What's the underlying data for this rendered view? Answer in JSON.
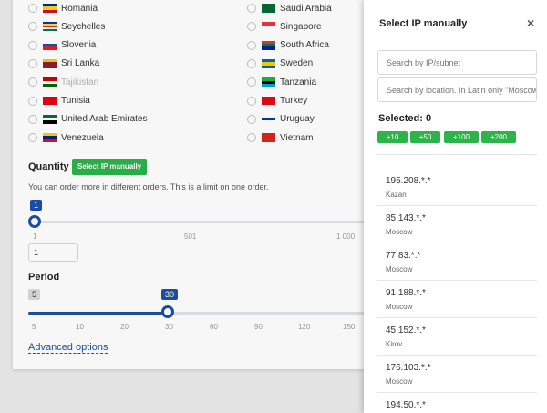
{
  "countries_left": [
    {
      "name": "Romania",
      "dim": false,
      "flag": [
        "#002b7f",
        "#fcd116",
        "#ce1126"
      ]
    },
    {
      "name": "Seychelles",
      "dim": false,
      "flag": [
        "#003f87",
        "#fcd856",
        "#d62828",
        "#ffffff",
        "#007a3d"
      ]
    },
    {
      "name": "Slovenia",
      "dim": false,
      "flag": [
        "#ffffff",
        "#005da4",
        "#ed1c24"
      ]
    },
    {
      "name": "Sri Lanka",
      "dim": false,
      "flag": [
        "#ffbe29",
        "#8d2029",
        "#8d2029"
      ]
    },
    {
      "name": "Tajikistan",
      "dim": true,
      "flag": [
        "#cc0000",
        "#ffffff",
        "#006600"
      ]
    },
    {
      "name": "Tunisia",
      "dim": false,
      "flag": [
        "#e70013",
        "#e70013",
        "#e70013"
      ]
    },
    {
      "name": "United Arab Emirates",
      "dim": false,
      "flag": [
        "#00732f",
        "#ffffff",
        "#000000"
      ]
    },
    {
      "name": "Venezuela",
      "dim": false,
      "flag": [
        "#ffcc00",
        "#00247d",
        "#cf142b"
      ]
    }
  ],
  "countries_right": [
    {
      "name": "Saudi Arabia",
      "dim": false,
      "flag": [
        "#006c35",
        "#006c35",
        "#006c35"
      ]
    },
    {
      "name": "Singapore",
      "dim": false,
      "flag": [
        "#ef3340",
        "#ffffff"
      ]
    },
    {
      "name": "South Africa",
      "dim": false,
      "flag": [
        "#de3831",
        "#007a4d",
        "#002395"
      ]
    },
    {
      "name": "Sweden",
      "dim": false,
      "flag": [
        "#006aa7",
        "#fecc00",
        "#006aa7"
      ]
    },
    {
      "name": "Tanzania",
      "dim": false,
      "flag": [
        "#1eb53a",
        "#000000",
        "#00a3dd"
      ]
    },
    {
      "name": "Turkey",
      "dim": false,
      "flag": [
        "#e30a17",
        "#e30a17",
        "#e30a17"
      ]
    },
    {
      "name": "Uruguay",
      "dim": false,
      "flag": [
        "#ffffff",
        "#0038a8",
        "#ffffff"
      ]
    },
    {
      "name": "Vietnam",
      "dim": false,
      "flag": [
        "#da251d",
        "#da251d",
        "#da251d"
      ]
    }
  ],
  "quantity": {
    "label": "Quantity",
    "select_button": "Select IP manually",
    "note": "You can order more in different orders. This is a limit on one order.",
    "value_bubble": "1",
    "ticks": [
      "1",
      "501",
      "1 000"
    ],
    "input_value": "1"
  },
  "period": {
    "label": "Period",
    "min_badge": "5",
    "value_bubble": "30",
    "value": 30,
    "ticks": [
      "5",
      "10",
      "20",
      "30",
      "60",
      "90",
      "120",
      "150"
    ]
  },
  "advanced_link": "Advanced options",
  "panel": {
    "title": "Select IP manually",
    "close": "×",
    "search_ip_placeholder": "Search by IP/subnet",
    "search_loc_placeholder": "Search by location. In Latin only \"Moscow\"",
    "selected": "Selected: 0",
    "chips": [
      "+10",
      "+50",
      "+100",
      "+200"
    ],
    "ips": [
      {
        "ip": "195.208.*.*",
        "loc": "Kazan"
      },
      {
        "ip": "85.143.*.*",
        "loc": "Moscow"
      },
      {
        "ip": "77.83.*.*",
        "loc": "Moscow"
      },
      {
        "ip": "91.188.*.*",
        "loc": "Moscow"
      },
      {
        "ip": "45.152.*.*",
        "loc": "Kirov"
      },
      {
        "ip": "176.103.*.*",
        "loc": "Moscow"
      },
      {
        "ip": "194.50.*.*",
        "loc": ""
      }
    ]
  },
  "colors": {
    "accent": "#1c4fa8",
    "green": "#2cb34a"
  }
}
